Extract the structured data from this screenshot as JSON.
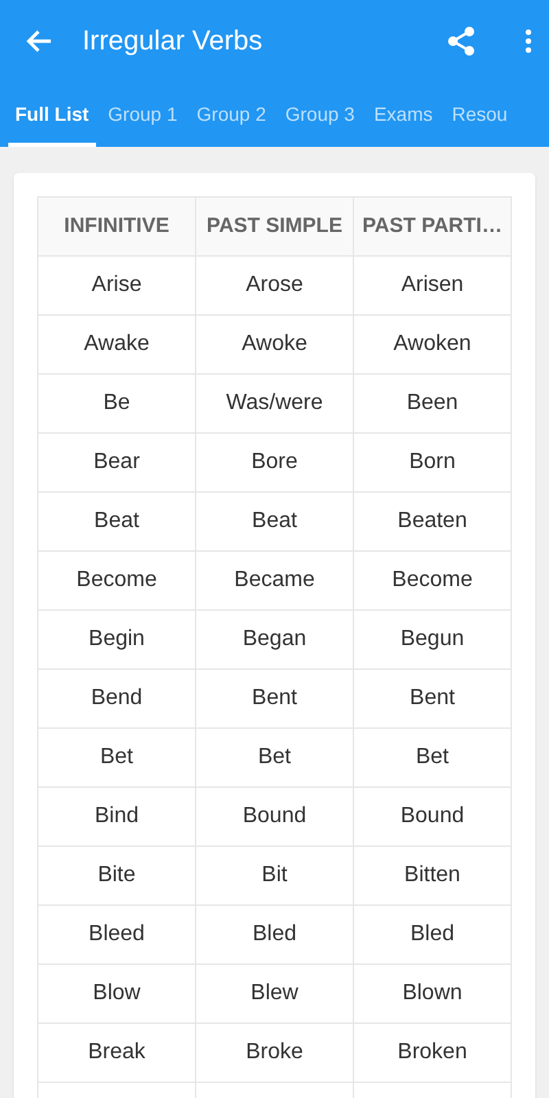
{
  "app_bar": {
    "title": "Irregular Verbs"
  },
  "tabs": [
    {
      "label": "Full List",
      "selected": true
    },
    {
      "label": "Group 1",
      "selected": false
    },
    {
      "label": "Group 2",
      "selected": false
    },
    {
      "label": "Group 3",
      "selected": false
    },
    {
      "label": "Exams",
      "selected": false
    },
    {
      "label": "Resou",
      "selected": false
    }
  ],
  "table": {
    "columns": [
      "INFINITIVE",
      "PAST SIMPLE",
      "PAST PARTI…"
    ],
    "rows": [
      [
        "Arise",
        "Arose",
        "Arisen"
      ],
      [
        "Awake",
        "Awoke",
        "Awoken"
      ],
      [
        "Be",
        "Was/were",
        "Been"
      ],
      [
        "Bear",
        "Bore",
        "Born"
      ],
      [
        "Beat",
        "Beat",
        "Beaten"
      ],
      [
        "Become",
        "Became",
        "Become"
      ],
      [
        "Begin",
        "Began",
        "Begun"
      ],
      [
        "Bend",
        "Bent",
        "Bent"
      ],
      [
        "Bet",
        "Bet",
        "Bet"
      ],
      [
        "Bind",
        "Bound",
        "Bound"
      ],
      [
        "Bite",
        "Bit",
        "Bitten"
      ],
      [
        "Bleed",
        "Bled",
        "Bled"
      ],
      [
        "Blow",
        "Blew",
        "Blown"
      ],
      [
        "Break",
        "Broke",
        "Broken"
      ]
    ]
  }
}
